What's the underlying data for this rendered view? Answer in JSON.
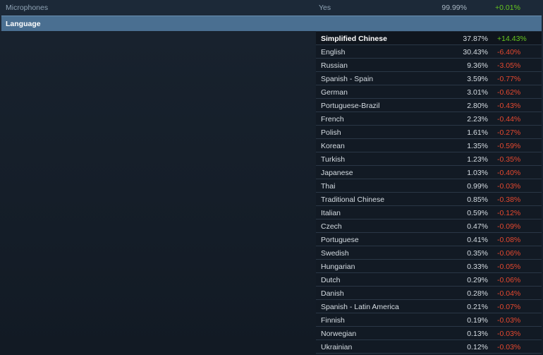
{
  "microphones": {
    "label": "Microphones",
    "value": "Yes",
    "percent": "99.99%",
    "change": "+0.01%"
  },
  "language_header": "Language",
  "languages": [
    {
      "name": "Simplified Chinese",
      "percent": "37.87%",
      "change": "+14.43%"
    },
    {
      "name": "English",
      "percent": "30.43%",
      "change": "-6.40%"
    },
    {
      "name": "Russian",
      "percent": "9.36%",
      "change": "-3.05%"
    },
    {
      "name": "Spanish - Spain",
      "percent": "3.59%",
      "change": "-0.77%"
    },
    {
      "name": "German",
      "percent": "3.01%",
      "change": "-0.62%"
    },
    {
      "name": "Portuguese-Brazil",
      "percent": "2.80%",
      "change": "-0.43%"
    },
    {
      "name": "French",
      "percent": "2.23%",
      "change": "-0.44%"
    },
    {
      "name": "Polish",
      "percent": "1.61%",
      "change": "-0.27%"
    },
    {
      "name": "Korean",
      "percent": "1.35%",
      "change": "-0.59%"
    },
    {
      "name": "Turkish",
      "percent": "1.23%",
      "change": "-0.35%"
    },
    {
      "name": "Japanese",
      "percent": "1.03%",
      "change": "-0.40%"
    },
    {
      "name": "Thai",
      "percent": "0.99%",
      "change": "-0.03%"
    },
    {
      "name": "Traditional Chinese",
      "percent": "0.85%",
      "change": "-0.38%"
    },
    {
      "name": "Italian",
      "percent": "0.59%",
      "change": "-0.12%"
    },
    {
      "name": "Czech",
      "percent": "0.47%",
      "change": "-0.09%"
    },
    {
      "name": "Portuguese",
      "percent": "0.41%",
      "change": "-0.08%"
    },
    {
      "name": "Swedish",
      "percent": "0.35%",
      "change": "-0.06%"
    },
    {
      "name": "Hungarian",
      "percent": "0.33%",
      "change": "-0.05%"
    },
    {
      "name": "Dutch",
      "percent": "0.29%",
      "change": "-0.06%"
    },
    {
      "name": "Danish",
      "percent": "0.28%",
      "change": "-0.04%"
    },
    {
      "name": "Spanish - Latin America",
      "percent": "0.21%",
      "change": "-0.07%"
    },
    {
      "name": "Finnish",
      "percent": "0.19%",
      "change": "-0.03%"
    },
    {
      "name": "Norwegian",
      "percent": "0.13%",
      "change": "-0.03%"
    },
    {
      "name": "Ukrainian",
      "percent": "0.12%",
      "change": "-0.03%"
    }
  ],
  "colors": {
    "positive": "#66c71f",
    "negative": "#e5482f",
    "header_bg": "#4a6f91"
  }
}
